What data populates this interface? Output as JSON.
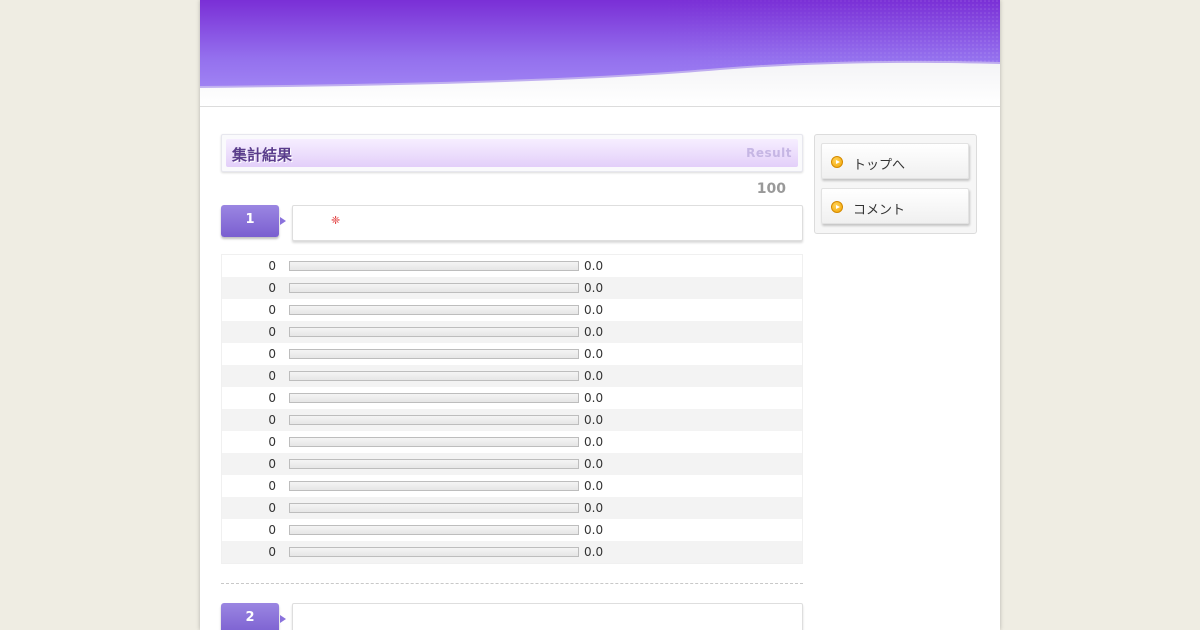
{
  "header": {
    "accent_top": "#7a2fd6",
    "accent_mid": "#9470ee",
    "accent_bottom": "#a68ef6"
  },
  "section": {
    "title": "集計結果",
    "title_en": "Result"
  },
  "total_count": "100",
  "questions": [
    {
      "number": "1",
      "results": [
        {
          "count": "0",
          "percent": "0.0",
          "fill": 0
        },
        {
          "count": "0",
          "percent": "0.0",
          "fill": 0
        },
        {
          "count": "0",
          "percent": "0.0",
          "fill": 0
        },
        {
          "count": "0",
          "percent": "0.0",
          "fill": 0
        },
        {
          "count": "0",
          "percent": "0.0",
          "fill": 0
        },
        {
          "count": "0",
          "percent": "0.0",
          "fill": 0
        },
        {
          "count": "0",
          "percent": "0.0",
          "fill": 0
        },
        {
          "count": "0",
          "percent": "0.0",
          "fill": 0
        },
        {
          "count": "0",
          "percent": "0.0",
          "fill": 0
        },
        {
          "count": "0",
          "percent": "0.0",
          "fill": 0
        },
        {
          "count": "0",
          "percent": "0.0",
          "fill": 0
        },
        {
          "count": "0",
          "percent": "0.0",
          "fill": 0
        },
        {
          "count": "0",
          "percent": "0.0",
          "fill": 0
        },
        {
          "count": "0",
          "percent": "0.0",
          "fill": 0
        }
      ]
    },
    {
      "number": "2",
      "results": []
    }
  ],
  "sidebar": {
    "items": [
      {
        "label": "トップへ",
        "icon": "play-circle-icon"
      },
      {
        "label": "コメント",
        "icon": "play-circle-icon"
      }
    ]
  }
}
